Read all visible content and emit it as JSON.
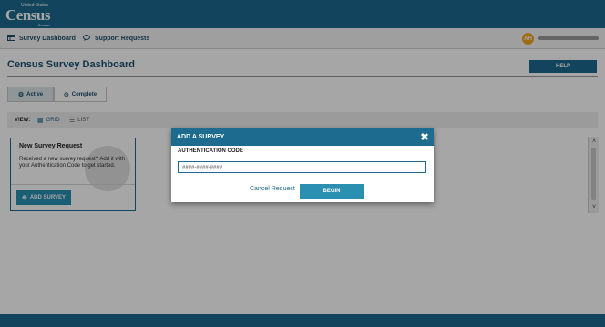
{
  "header": {
    "logo_small": "United States",
    "logo_big": "Census",
    "logo_bureau": "Bureau"
  },
  "nav": {
    "items": [
      {
        "label": "Survey Dashboard",
        "icon": "dashboard-icon"
      },
      {
        "label": "Support Requests",
        "icon": "chat-icon"
      }
    ],
    "user_initials": "AH"
  },
  "main": {
    "title": "Census Survey Dashboard",
    "help_label": "HELP",
    "tabs": [
      {
        "label": "Active",
        "icon": "gear-icon",
        "selected": true
      },
      {
        "label": "Complete",
        "icon": "check-circle-icon",
        "selected": false
      }
    ],
    "view": {
      "label": "VIEW:",
      "options": [
        {
          "label": "GRID",
          "icon": "grid-icon",
          "selected": true
        },
        {
          "label": "LIST",
          "icon": "list-icon",
          "selected": false
        }
      ]
    },
    "card": {
      "title": "New Survey Request",
      "text": "Received a new survey request? Add it with your Authentication Code to get started.",
      "button_label": "ADD SURVEY"
    }
  },
  "modal": {
    "title": "ADD A SURVEY",
    "field_label": "AUTHENTICATION CODE",
    "field_placeholder": "####-####-####",
    "field_value": "",
    "cancel_label": "Cancel Request",
    "begin_label": "BEGIN"
  },
  "colors": {
    "brand": "#1d6b8f",
    "button": "#2a8fb0",
    "avatar": "#f0a81c"
  }
}
